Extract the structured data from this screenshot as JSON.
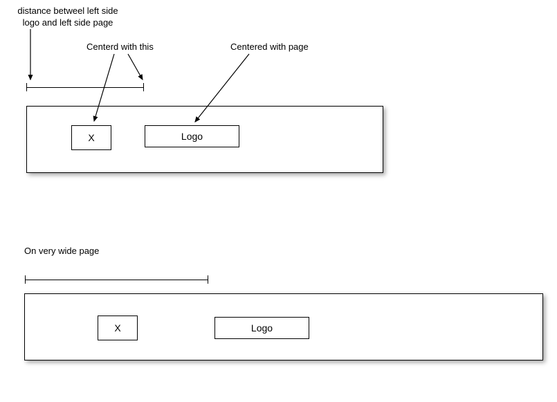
{
  "annotations": {
    "left_distance": "distance betweel left side\n logo and left side page",
    "centered_with_this": "Centerd with this",
    "centered_with_page": "Centered  with page",
    "on_wide_page": "On very wide  page"
  },
  "page1": {
    "x_label": "X",
    "logo_label": "Logo"
  },
  "page2": {
    "x_label": "X",
    "logo_label": "Logo"
  }
}
